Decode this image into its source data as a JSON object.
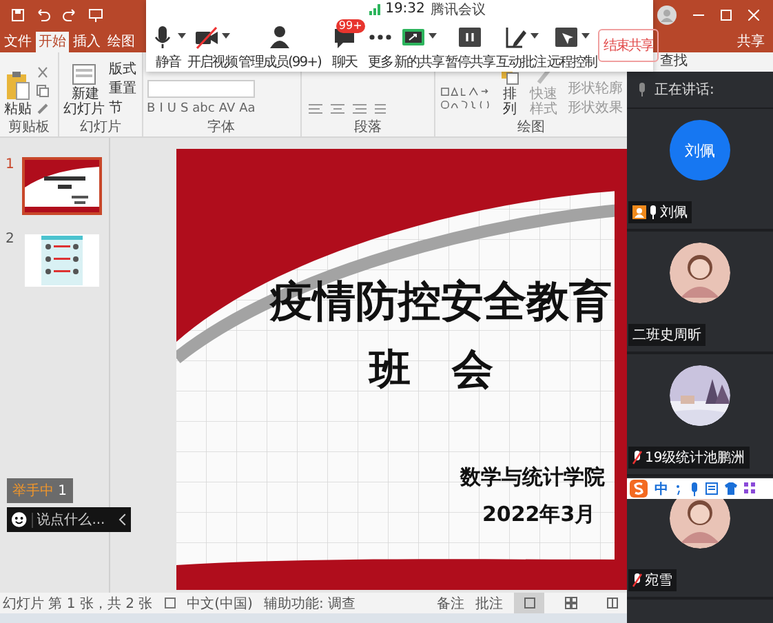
{
  "ribbon_tabs": [
    {
      "label": "文件",
      "selected": false
    },
    {
      "label": "开始",
      "selected": true
    },
    {
      "label": "插入",
      "selected": false
    },
    {
      "label": "绘图",
      "selected": false
    }
  ],
  "share_button": "共享",
  "find_button": "查找",
  "ribbon": {
    "clipboard": {
      "label": "剪贴板",
      "paste": "粘贴"
    },
    "slides": {
      "label": "幻灯片",
      "new_slide": "新建幻灯片",
      "layout": "版式",
      "reset": "重置",
      "section": "节"
    },
    "font": {
      "label": "字体",
      "buttons": [
        "B",
        "I",
        "U",
        "S",
        "abc",
        "AV",
        "Aa"
      ]
    },
    "paragraph": {
      "label": "段落"
    },
    "drawing": {
      "label": "绘图",
      "arrange": "排列",
      "quick_styles": "快速样式",
      "shape_outline": "形状轮廓",
      "shape_effects": "形状效果"
    }
  },
  "meeting_toolbar": {
    "time": "19:32",
    "title": "腾讯会议",
    "buttons": [
      {
        "label": "静音",
        "kind": "mic",
        "dropdown": true
      },
      {
        "label": "开启视频",
        "kind": "video_off",
        "dropdown": true
      },
      {
        "label": "管理成员(99+)",
        "kind": "members",
        "dropdown": false
      },
      {
        "label": "聊天",
        "kind": "chat",
        "dropdown": false,
        "badge": "99+"
      },
      {
        "label": "更多",
        "kind": "more",
        "dropdown": false
      },
      {
        "label": "新的共享",
        "kind": "share",
        "dropdown": true
      },
      {
        "label": "暂停共享",
        "kind": "pause",
        "dropdown": false
      },
      {
        "label": "互动批注",
        "kind": "annotate",
        "dropdown": true
      },
      {
        "label": "远程控制",
        "kind": "remote",
        "dropdown": true
      }
    ],
    "end_button": "结束共享"
  },
  "thumbnails": [
    {
      "number": "1",
      "selected": true,
      "kind": "title"
    },
    {
      "number": "2",
      "selected": false,
      "kind": "chart"
    }
  ],
  "hand_raise": {
    "label": "举手中",
    "count": "1"
  },
  "chat_input": {
    "placeholder": "说点什么..."
  },
  "slide": {
    "title": "疫情防控安全教育",
    "subtitle": "班　会",
    "organization": "数学与统计学院",
    "date": "2022年3月"
  },
  "status_bar": {
    "slide_info": "幻灯片 第 1 张，共 2 张",
    "language": "中文(中国)",
    "accessibility": "辅助功能: 调查",
    "notes": "备注",
    "comments": "批注",
    "views": [
      {
        "kind": "normal",
        "selected": true
      },
      {
        "kind": "sorter",
        "selected": false
      },
      {
        "kind": "reading",
        "selected": false
      }
    ]
  },
  "participants_panel": {
    "header": "正在讲话:",
    "participants": [
      {
        "name": "刘佩",
        "kind": "initials",
        "avatar_text": "刘佩",
        "host": true,
        "muted": false
      },
      {
        "name": "二班史周昕",
        "host": false
      },
      {
        "name": "19级统计池鹏洲",
        "kind": "picture",
        "host": false,
        "muted": true
      },
      {
        "name": "宛雪",
        "host": false,
        "muted": true
      }
    ]
  },
  "ime_bar": {
    "label": "中"
  }
}
